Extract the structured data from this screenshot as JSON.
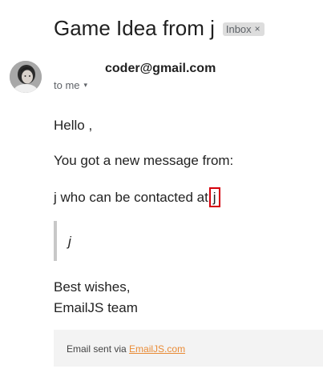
{
  "email": {
    "subject": "Game Idea from j",
    "label": "Inbox",
    "label_close": "×",
    "sender": "coder@gmail.com",
    "recipient_line": "to me",
    "recipient_caret": "▾"
  },
  "body": {
    "greeting": "Hello ,",
    "line1": "You got a new message from:",
    "line2_prefix": "j who can be contacted at",
    "line2_contact": "j",
    "quote": "j",
    "signoff_line1": "Best wishes,",
    "signoff_line2": "EmailJS team"
  },
  "footer": {
    "prefix": "Email sent via",
    "link_text": "EmailJS.com"
  },
  "colors": {
    "highlight_border": "#d5000c",
    "footer_link": "#e98b36",
    "label_chip_bg": "#dddddd"
  },
  "icons": {
    "avatar": "avatar-portrait",
    "label_close": "close-icon",
    "recipient_caret": "caret-down-icon"
  }
}
